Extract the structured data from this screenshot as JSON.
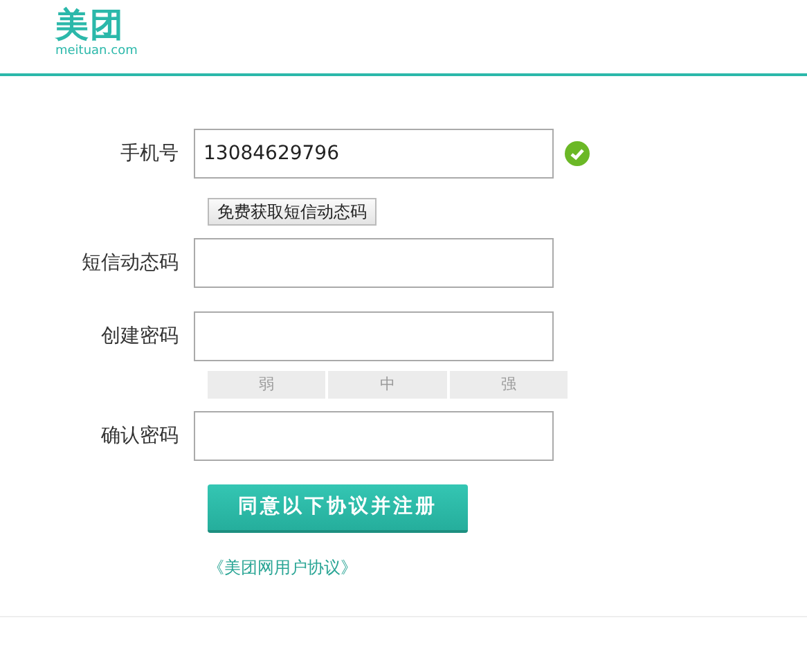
{
  "logo": {
    "name": "美团",
    "domain": "meituan.com"
  },
  "fields": [
    {
      "label": "手机号",
      "value": "13084629796",
      "valid": true
    },
    {
      "label": "短信动态码",
      "valid": false
    },
    {
      "label": "创建密码",
      "valid": false
    },
    {
      "label": "确认密码",
      "valid": false
    }
  ],
  "sms_button": "免费获取短信动态码",
  "strength": [
    {
      "label": "弱",
      "active": false
    },
    {
      "label": "中",
      "active": false
    },
    {
      "label": "强",
      "active": false
    }
  ],
  "submit_button": "同意以下协议并注册",
  "agreement_link": "《美团网用户协议》"
}
